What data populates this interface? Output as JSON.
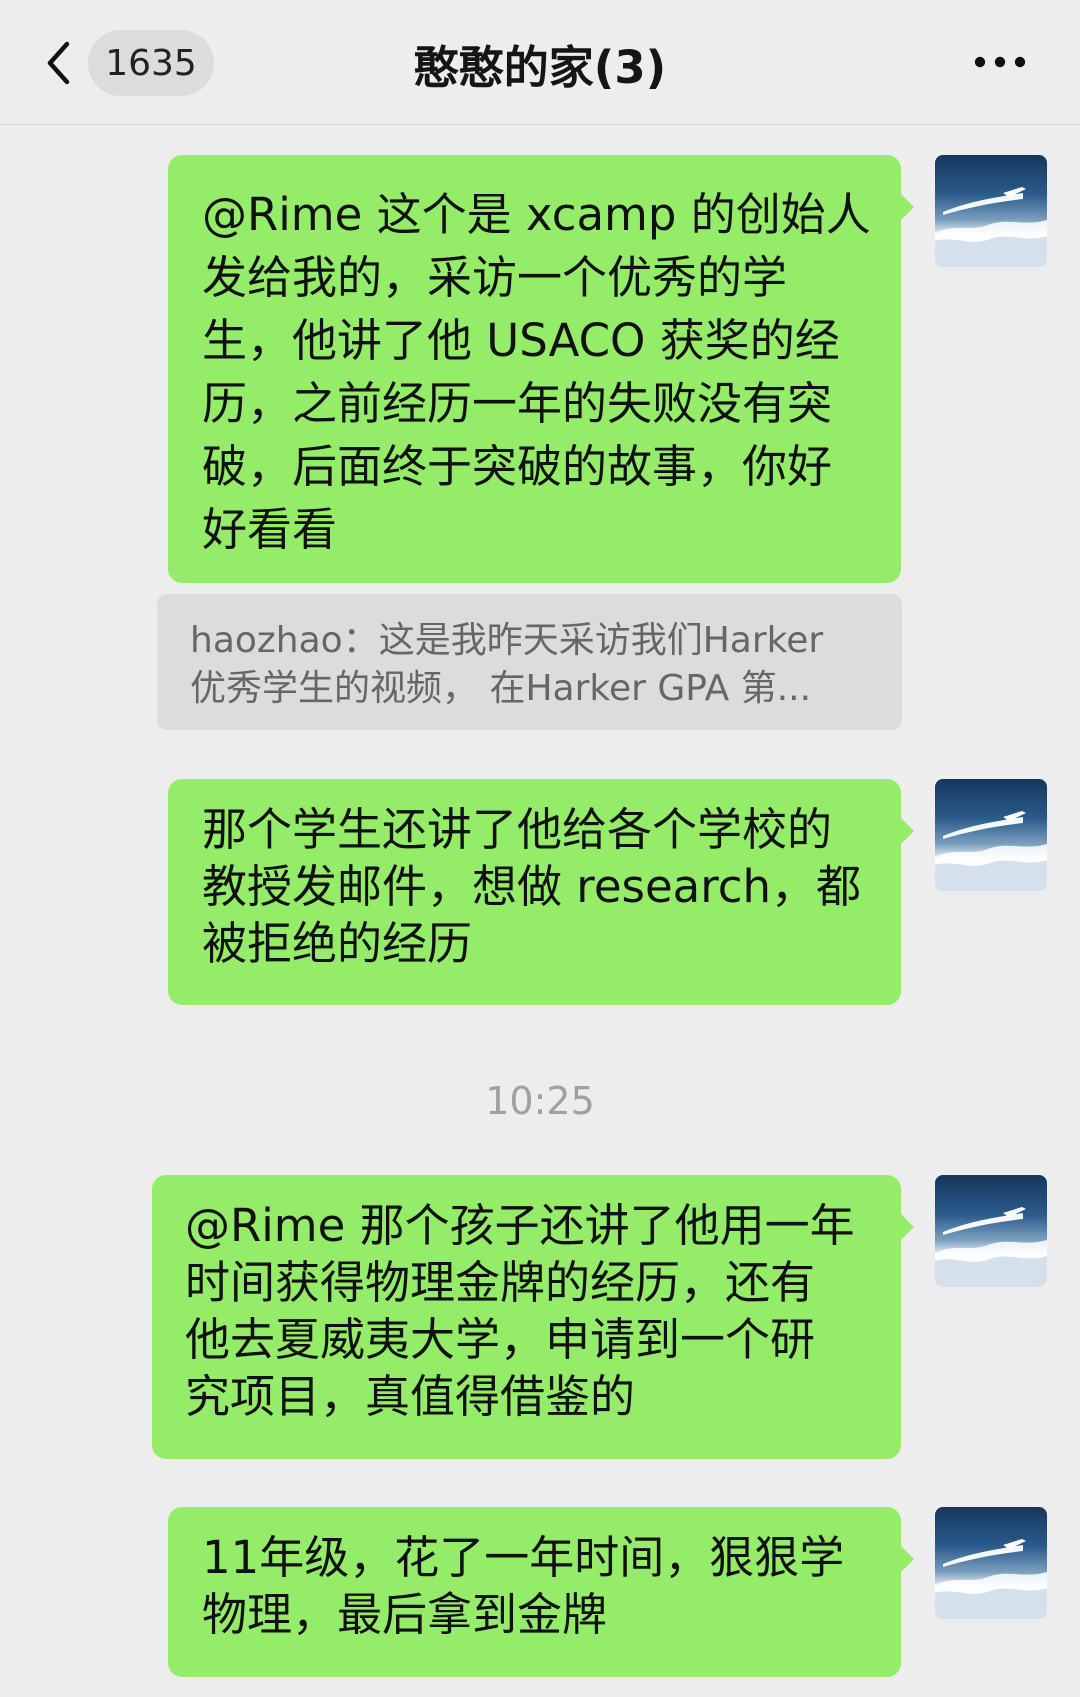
{
  "header": {
    "back_icon": "chevron-left-icon",
    "unread_count": "1635",
    "title": "憨憨的家(3)",
    "more_icon": "more-horizontal-icon"
  },
  "messages": [
    {
      "mention": "@Rime",
      "lines": [
        "@Rime 这个是 xcamp 的创始人",
        "发给我的，采访一个优秀的学",
        "生，他讲了他 USACO 获奖的经",
        "历，之前经历一年的失败没有突",
        "破，后面终于突破的故事，你好",
        "好看看"
      ]
    },
    {
      "lines": [
        "那个学生还讲了他给各个学校的",
        "教授发邮件，想做 research，都",
        "被拒绝的经历"
      ]
    },
    {
      "mention": "@Rime",
      "lines": [
        "@Rime 那个孩子还讲了他用一年",
        "时间获得物理金牌的经历，还有",
        "他去夏威夷大学，申请到一个研",
        "究项目，真值得借鉴的"
      ]
    },
    {
      "lines": [
        "11年级，花了一年时间，狠狠学",
        "物理，最后拿到金牌"
      ]
    }
  ],
  "quote": {
    "sender": "haozhao",
    "line_1": "haozhao：这是我昨天采访我们Harker",
    "line_2": "优秀学生的视频， 在Harker GPA 第..."
  },
  "timestamp": "10:25",
  "avatar": {
    "icon": "sky-airplane-avatar-icon"
  },
  "colors": {
    "background": "#ededed",
    "bubble_green": "#95ec69",
    "quote_bg": "#dcdcdc",
    "timestamp_text": "#a0a0a0"
  }
}
